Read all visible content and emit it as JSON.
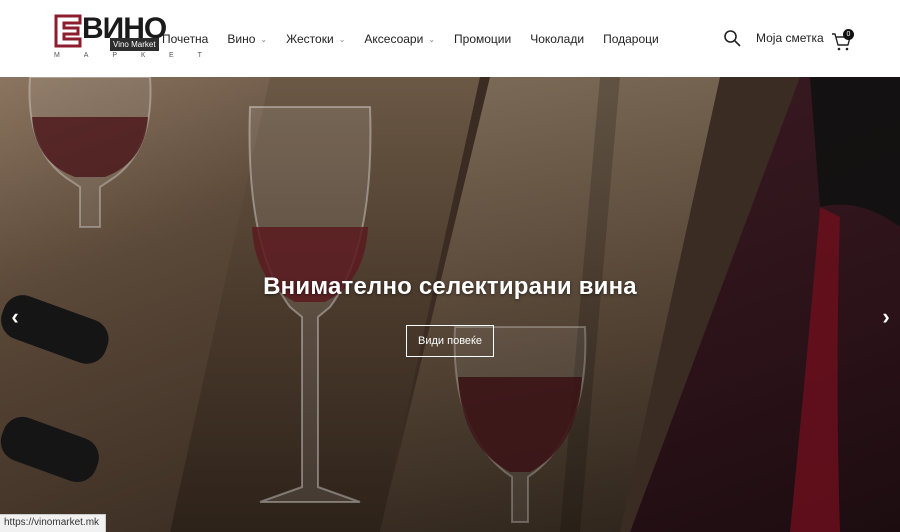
{
  "logo": {
    "word": "ВИНО",
    "badge": "Vino Market",
    "sub": "М А Р К Е Т",
    "brand_color": "#8b1d2c"
  },
  "nav": {
    "items": [
      {
        "label": "Почетна",
        "dropdown": false
      },
      {
        "label": "Вино",
        "dropdown": true
      },
      {
        "label": "Жестоки",
        "dropdown": true
      },
      {
        "label": "Аксесоари",
        "dropdown": true
      },
      {
        "label": "Промоции",
        "dropdown": false
      },
      {
        "label": "Чоколади",
        "dropdown": false
      },
      {
        "label": "Подароци",
        "dropdown": false
      }
    ]
  },
  "header": {
    "search_icon": "search-icon",
    "account_label": "Моја сметка",
    "cart_icon": "cart-icon",
    "cart_count": "0"
  },
  "hero": {
    "title": "Внимателно селектирани вина",
    "button_label": "Види повеќе",
    "prev_glyph": "‹",
    "next_glyph": "›"
  },
  "status_bar": {
    "url": "https://vinomarket.mk"
  }
}
